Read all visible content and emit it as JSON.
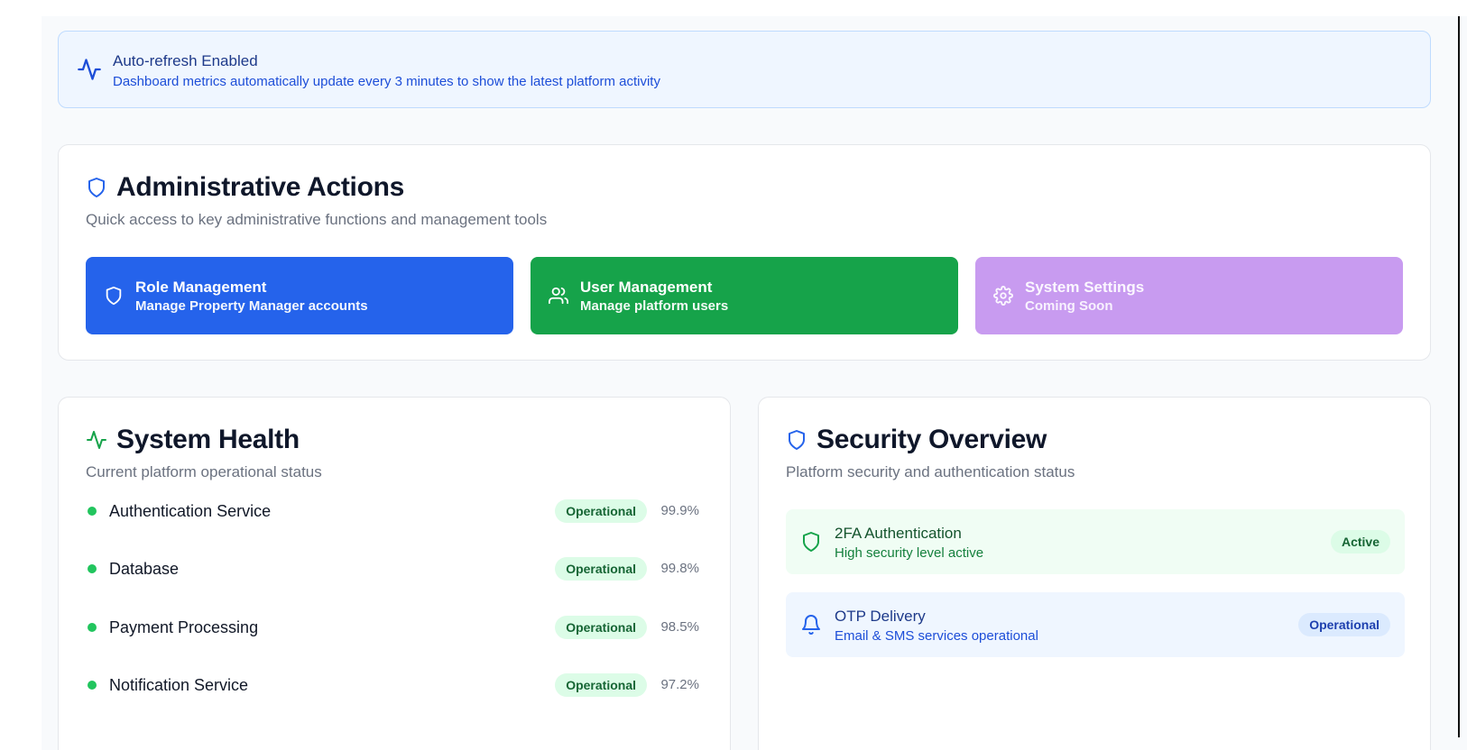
{
  "banner": {
    "title": "Auto-refresh Enabled",
    "description": "Dashboard metrics automatically update every 3 minutes to show the latest platform activity",
    "icon": "activity-icon"
  },
  "admin": {
    "title": "Administrative Actions",
    "subtitle": "Quick access to key administrative functions and management tools",
    "icon": "shield-icon",
    "actions": [
      {
        "label": "Role Management",
        "description": "Manage Property Manager accounts",
        "icon": "shield-icon",
        "color": "#2563eb"
      },
      {
        "label": "User Management",
        "description": "Manage platform users",
        "icon": "users-icon",
        "color": "#16a34a"
      },
      {
        "label": "System Settings",
        "description": "Coming Soon",
        "icon": "gear-icon",
        "color": "#c89bf0"
      }
    ]
  },
  "health": {
    "title": "System Health",
    "subtitle": "Current platform operational status",
    "icon": "activity-icon",
    "services": [
      {
        "name": "Authentication Service",
        "status": "Operational",
        "uptime": "99.9%"
      },
      {
        "name": "Database",
        "status": "Operational",
        "uptime": "99.8%"
      },
      {
        "name": "Payment Processing",
        "status": "Operational",
        "uptime": "98.5%"
      },
      {
        "name": "Notification Service",
        "status": "Operational",
        "uptime": "97.2%"
      }
    ]
  },
  "security": {
    "title": "Security Overview",
    "subtitle": "Platform security and authentication status",
    "icon": "shield-icon",
    "items": [
      {
        "title": "2FA Authentication",
        "description": "High security level active",
        "badge": "Active",
        "icon": "shield-icon",
        "color": "#16a34a"
      },
      {
        "title": "OTP Delivery",
        "description": "Email & SMS services operational",
        "badge": "Operational",
        "icon": "bell-icon",
        "color": "#2563eb"
      }
    ]
  }
}
